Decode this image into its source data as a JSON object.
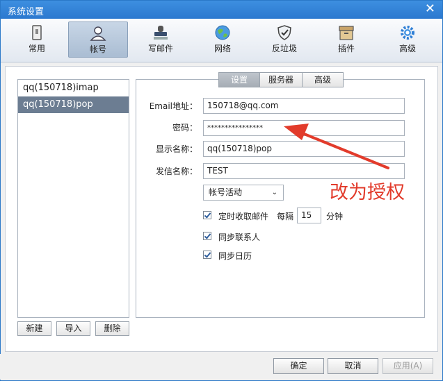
{
  "window": {
    "title": "系统设置"
  },
  "toolbar": {
    "items": [
      {
        "label": "常用",
        "icon": "phone-device-icon"
      },
      {
        "label": "帐号",
        "icon": "user-icon"
      },
      {
        "label": "写邮件",
        "icon": "stamp-icon"
      },
      {
        "label": "网络",
        "icon": "globe-icon"
      },
      {
        "label": "反垃圾",
        "icon": "shield-icon"
      },
      {
        "label": "插件",
        "icon": "box-icon"
      },
      {
        "label": "高级",
        "icon": "gear-icon"
      }
    ],
    "active": "帐号"
  },
  "accounts": {
    "items": [
      "qq(150718)imap",
      "qq(150718)pop"
    ],
    "selected": "qq(150718)pop",
    "buttons": {
      "new": "新建",
      "import": "导入",
      "delete": "删除"
    }
  },
  "tabs": {
    "items": [
      "设置",
      "服务器",
      "高级"
    ],
    "active": "设置"
  },
  "form": {
    "email_label": "Email地址：",
    "email_value": "150718@qq.com",
    "password_label": "密码：",
    "password_value": "****************",
    "display_label": "显示名称：",
    "display_value": "qq(150718)pop",
    "sender_label": "发信名称：",
    "sender_value": "TEST",
    "status_select": "帐号活动",
    "timed_check_label": "定时收取邮件",
    "interval_prefix": "每隔",
    "interval_value": "15",
    "interval_unit": "分钟",
    "sync_contacts_label": "同步联系人",
    "sync_calendar_label": "同步日历"
  },
  "annotation": {
    "text": "改为授权",
    "color": "#e23b2b"
  },
  "footer": {
    "ok": "确定",
    "cancel": "取消",
    "apply": "应用(A)"
  }
}
